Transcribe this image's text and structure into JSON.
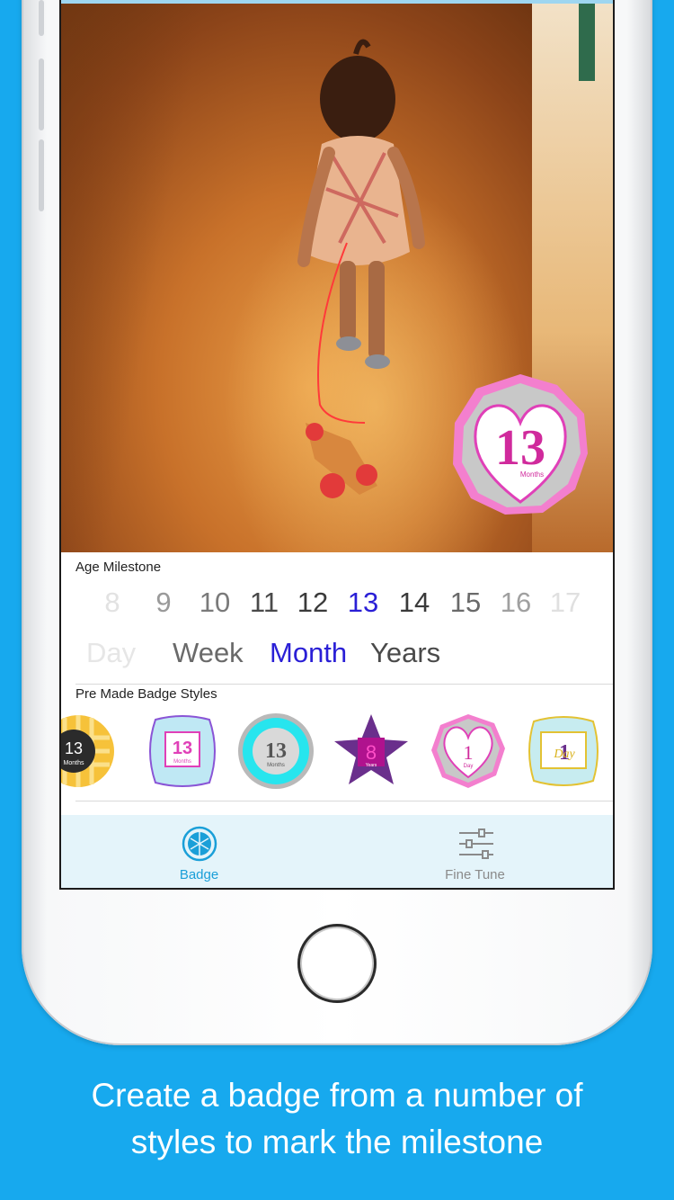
{
  "photo": {
    "badge": {
      "number": "13",
      "unit": "Months"
    }
  },
  "age_milestone": {
    "label": "Age Milestone",
    "numbers": [
      "8",
      "9",
      "10",
      "11",
      "12",
      "13",
      "14",
      "15",
      "16",
      "17"
    ],
    "selected_number": "13",
    "units": [
      "Day",
      "Week",
      "Month",
      "Years"
    ],
    "selected_unit": "Month"
  },
  "badge_styles": {
    "label": "Pre Made Badge Styles",
    "items": [
      {
        "number": "13",
        "unit": "Months"
      },
      {
        "number": "13",
        "unit": "Months"
      },
      {
        "number": "13",
        "unit": "Months"
      },
      {
        "number": "8",
        "unit": "Years"
      },
      {
        "number": "1",
        "unit": "Day"
      },
      {
        "number": "1",
        "unit": "Day"
      }
    ]
  },
  "tabbar": {
    "badge_label": "Badge",
    "fine_tune_label": "Fine Tune"
  },
  "caption": {
    "line1": "Create a badge from a number of",
    "line2": "styles to mark the milestone"
  },
  "colors": {
    "background": "#17a9ee",
    "accent": "#2a1fd6",
    "tab_active": "#1a9fd8",
    "tab_inactive": "#8a8a8a",
    "badge_pink": "#e040b8"
  }
}
